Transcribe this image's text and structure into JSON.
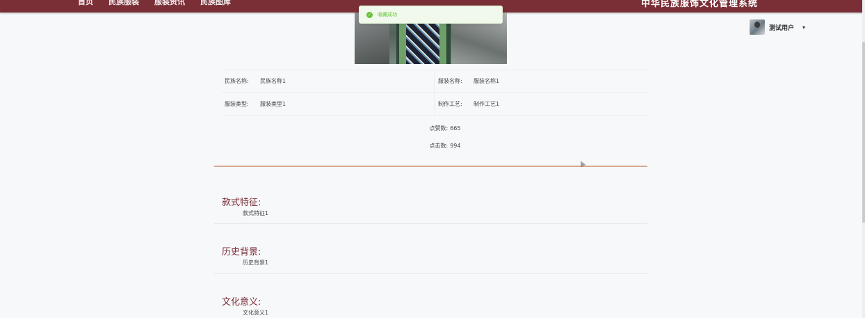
{
  "header": {
    "nav": [
      "首页",
      "民族服装",
      "服装资讯",
      "民族图库"
    ],
    "brand": "中华民族服饰文化管理系统"
  },
  "user": {
    "name": "测试用户",
    "caret": "▾"
  },
  "toast": {
    "message": "收藏成功",
    "type": "success"
  },
  "info": {
    "rows": [
      [
        {
          "label": "民族名称:",
          "value": "民族名称1"
        },
        {
          "label": "服装名称:",
          "value": "服装名称1"
        }
      ],
      [
        {
          "label": "服装类型:",
          "value": "服装类型1"
        },
        {
          "label": "制作工艺:",
          "value": "制作工艺1"
        }
      ]
    ]
  },
  "stats": {
    "likes_label": "点赞数:",
    "likes": "665",
    "clicks_label": "点击数:",
    "clicks": "994"
  },
  "sections": [
    {
      "title": "款式特征:",
      "content": "款式特征1"
    },
    {
      "title": "历史背景:",
      "content": "历史背景1"
    },
    {
      "title": "文化意义:",
      "content": "文化意义1"
    }
  ],
  "colors": {
    "primary": "#7a2e36",
    "success": "#67c23a",
    "divider": "#d5a890"
  }
}
